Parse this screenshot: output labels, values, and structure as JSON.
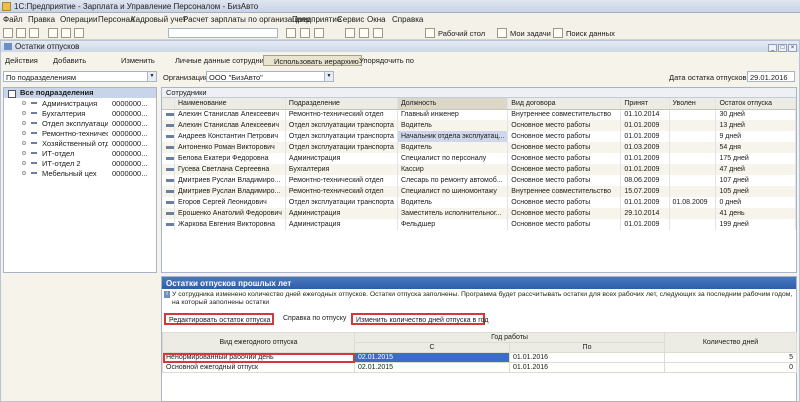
{
  "window_title": "1С:Предприятие - Зарплата и Управление Персоналом - БизАвто",
  "menu": [
    "Файл",
    "Правка",
    "Операции",
    "Персонал",
    "Кадровый учет",
    "Расчет зарплаты по организациям",
    "Предприятие",
    "Сервис",
    "Окна",
    "Справка"
  ],
  "toolbar": {
    "desktop": "Рабочий стол",
    "my_tasks": "Мои задачи",
    "search": "Поиск данных"
  },
  "form_title": "Остатки отпусков",
  "actions": {
    "menu": "Действия",
    "add": "Добавить",
    "edit": "Изменить",
    "personal": "Личные данные сотрудника",
    "hierarchy": "Использовать иерархию",
    "sort": "Упорядочить по"
  },
  "filter": {
    "grouping": "По подразделениям",
    "org_label": "Организация:",
    "org_value": "ООО \"БизАвто\"",
    "date_label": "Дата остатка отпусков:",
    "date_value": "29.01.2016"
  },
  "tree": {
    "root": "Все подразделения",
    "items": [
      {
        "name": "Администрация",
        "code": "0000000..."
      },
      {
        "name": "Бухгалтерия",
        "code": "0000000..."
      },
      {
        "name": "Отдел эксплуатаци...",
        "code": "0000000..."
      },
      {
        "name": "Ремонтно-техническ...",
        "code": "0000000..."
      },
      {
        "name": "Хозяйственный отдел",
        "code": "0000000..."
      },
      {
        "name": "ИТ-отдел",
        "code": "0000000..."
      },
      {
        "name": "ИТ-отдел 2",
        "code": "0000000..."
      },
      {
        "name": "Мебельный цех",
        "code": "0000000..."
      }
    ]
  },
  "employees": {
    "title": "Сотрудники",
    "columns": [
      "Наименование",
      "Подразделение",
      "Должность",
      "Вид договора",
      "Принят",
      "Уволен",
      "Остаток отпуска"
    ],
    "rows": [
      [
        "Алехин Станислав Алексеевич",
        "Ремонтно-технический отдел",
        "Главный инженер",
        "Внутреннее совместительство",
        "01.10.2014",
        "",
        "30 дней"
      ],
      [
        "Алехин Станислав Алексеевич",
        "Отдел эксплуатации транспорта",
        "Водитель",
        "Основное место работы",
        "01.01.2009",
        "",
        "13 дней"
      ],
      [
        "Андреев Константин Петрович",
        "Отдел эксплуатации транспорта",
        "Начальник отдела эксплуатац...",
        "Основное место работы",
        "01.01.2009",
        "",
        "9 дней"
      ],
      [
        "Антоненко Роман Викторович",
        "Отдел эксплуатации транспорта",
        "Водитель",
        "Основное место работы",
        "01.03.2009",
        "",
        "54 дня"
      ],
      [
        "Белова Екатери Федоровна",
        "Администрация",
        "Специалист по персоналу",
        "Основное место работы",
        "01.01.2009",
        "",
        "175 дней"
      ],
      [
        "Гусева Светлана Сергеевна",
        "Бухгалтерия",
        "Кассир",
        "Основное место работы",
        "01.01.2009",
        "",
        "47 дней"
      ],
      [
        "Дмитриев Руслан Владимиро...",
        "Ремонтно-технический отдел",
        "Слесарь по ремонту автомоб...",
        "Основное место работы",
        "08.06.2009",
        "",
        "107 дней"
      ],
      [
        "Дмитриев Руслан Владимиро...",
        "Ремонтно-технический отдел",
        "Специалист по шиномонтажу",
        "Внутреннее совместительство",
        "15.07.2009",
        "",
        "105 дней"
      ],
      [
        "Егоров Сергей Леонидович",
        "Отдел эксплуатации транспорта",
        "Водитель",
        "Основное место работы",
        "01.01.2009",
        "01.08.2009",
        "0 дней"
      ],
      [
        "Ерошенко Анатолий Федорович",
        "Администрация",
        "Заместитель исполнительног...",
        "Основное место работы",
        "29.10.2014",
        "",
        "41 день"
      ],
      [
        "Жаркова Евгения Викторовна",
        "Администрация",
        "Фельдшер",
        "Основное место работы",
        "01.01.2009",
        "",
        "199 дней"
      ]
    ]
  },
  "balances": {
    "title": "Остатки отпусков прошлых лет",
    "info": "У сотрудника изменено количество дней ежегодных отпусков. Остатки отпуска заполнены. Программа будет рассчитывать остатки для всех рабочих лет, следующих за последним рабочим годом, на который заполнены остатки",
    "btn_edit": "Редактировать остаток отпуска",
    "btn_help": "Справка по отпуску",
    "btn_change": "Изменить количество дней отпуска в год",
    "col_kind": "Вид ежегодного отпуска",
    "col_year": "Год работы",
    "col_from": "С",
    "col_to": "По",
    "col_days": "Количество дней",
    "rows": [
      {
        "kind": "Ненормированный рабочий день",
        "from": "02.01.2015",
        "to": "01.01.2016",
        "days": "5"
      },
      {
        "kind": "Основной ежегодный отпуск",
        "from": "02.01.2015",
        "to": "01.01.2016",
        "days": "0"
      }
    ]
  }
}
